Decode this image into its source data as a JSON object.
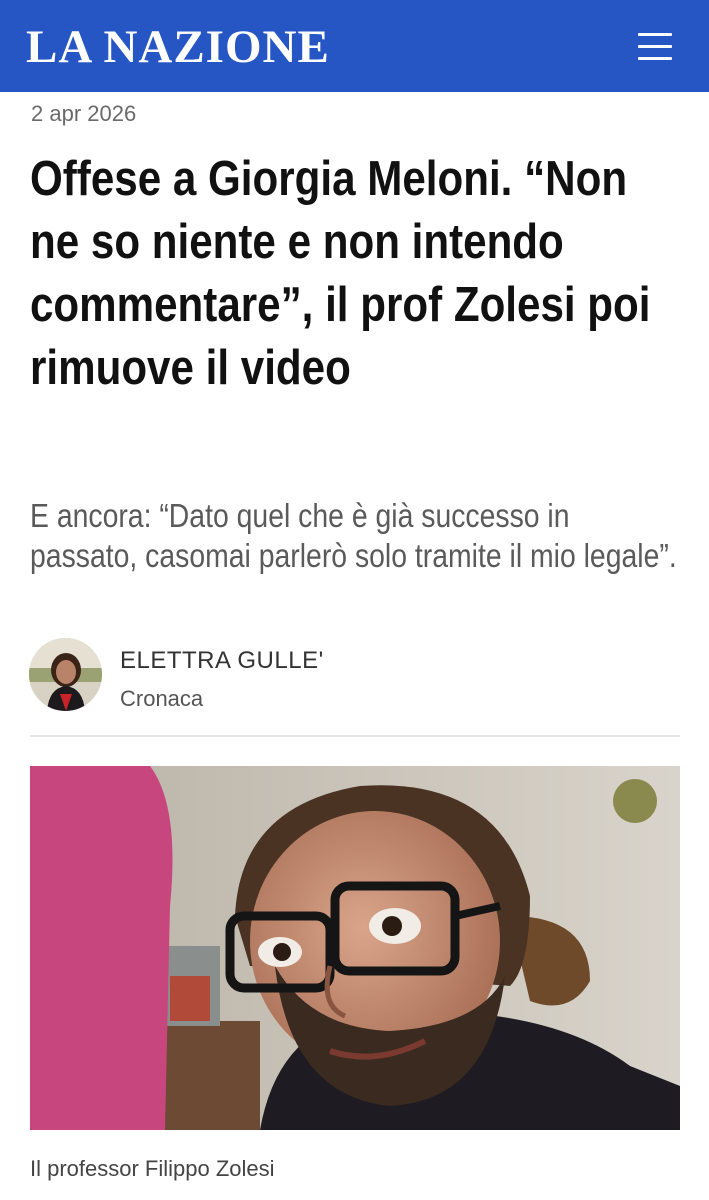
{
  "header": {
    "logo": "LA NAZIONE",
    "menu_icon": "hamburger-menu-icon",
    "background_color": "#2556c4"
  },
  "article": {
    "date": "2 apr 2026",
    "headline": "Offese a Giorgia Meloni. “Non ne so niente e non intendo commentare”, il prof Zolesi poi rimuove il video",
    "subtitle": "E ancora: “Dato quel che è già successo in passato, casomai parlerò solo tramite il mio legale”.",
    "author": "ELETTRA GULLE'",
    "section": "Cronaca",
    "image_caption": "Il professor Filippo Zolesi"
  }
}
